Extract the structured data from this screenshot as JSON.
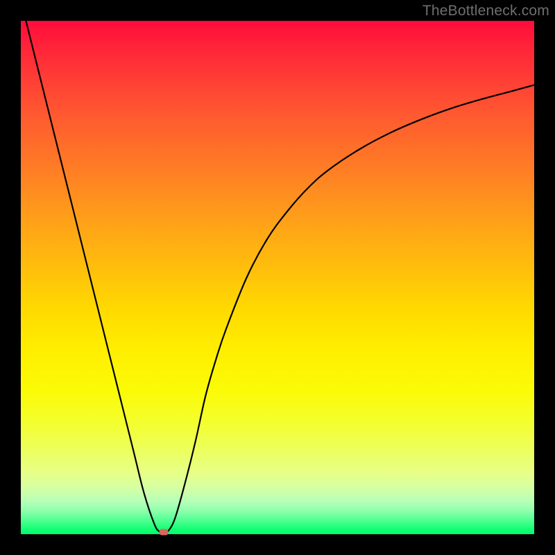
{
  "attribution": "TheBottleneck.com",
  "colors": {
    "marker": "#d9675e",
    "curve": "#000000"
  },
  "chart_data": {
    "type": "line",
    "title": "",
    "xlabel": "",
    "ylabel": "",
    "xlim": [
      0,
      100
    ],
    "ylim": [
      0,
      100
    ],
    "series": [
      {
        "name": "bottleneck-curve",
        "x": [
          0,
          2,
          4,
          6,
          8,
          10,
          12,
          14,
          16,
          18,
          20,
          22,
          24,
          26,
          27,
          27.8,
          28.6,
          30,
          32,
          34,
          36,
          38,
          40,
          44,
          48,
          52,
          56,
          60,
          66,
          72,
          78,
          84,
          90,
          96,
          100
        ],
        "values": [
          104,
          96,
          88,
          80,
          72,
          64,
          56,
          48,
          40,
          32,
          24,
          16,
          8,
          2,
          0.5,
          0.2,
          0.5,
          3,
          10,
          18,
          27,
          34,
          40,
          50,
          57.5,
          63,
          67.5,
          71,
          75,
          78.2,
          80.8,
          83,
          84.8,
          86.4,
          87.5
        ]
      }
    ],
    "marker": {
      "x": 27.8,
      "y": 0.4
    },
    "background_gradient": {
      "orientation": "vertical",
      "stops": [
        {
          "pos": 0.0,
          "color": "#ff0b3b"
        },
        {
          "pos": 0.5,
          "color": "#ffd900"
        },
        {
          "pos": 0.8,
          "color": "#f4fe2c"
        },
        {
          "pos": 1.0,
          "color": "#00ff6b"
        }
      ]
    }
  }
}
